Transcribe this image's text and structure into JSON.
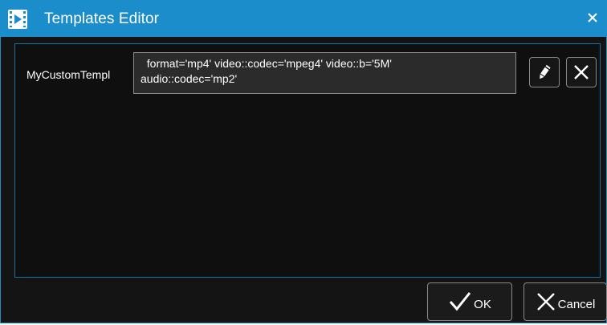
{
  "window": {
    "title": "Templates Editor",
    "title_bar_color": "#1b8dca",
    "background_color": "#141414"
  },
  "icons": {
    "app": "video-clip-icon",
    "close": "close-icon",
    "edit": "pencil-icon",
    "delete": "close-icon",
    "ok": "checkmark-icon",
    "cancel": "close-icon"
  },
  "templates": [
    {
      "name": "MyCustomTempl",
      "value": "  format='mp4' video::codec='mpeg4' video::b='5M'\naudio::codec='mp2'"
    }
  ],
  "footer": {
    "ok_label": "OK",
    "cancel_label": "Cancel"
  }
}
